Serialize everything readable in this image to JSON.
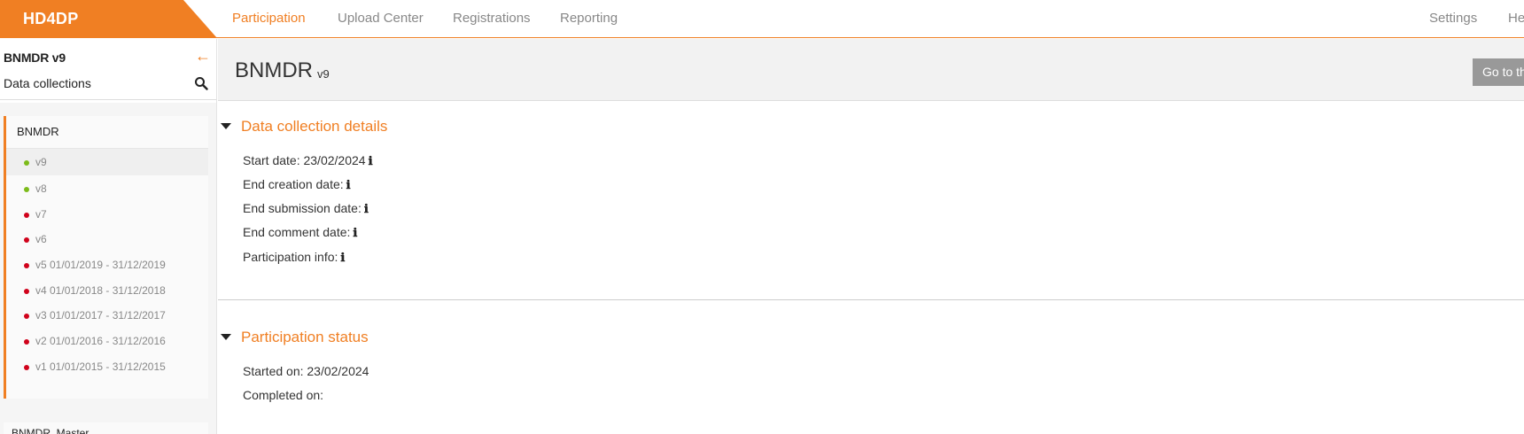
{
  "app": {
    "logo": "HD4DP"
  },
  "nav": {
    "participation": "Participation",
    "upload_center": "Upload Center",
    "registrations": "Registrations",
    "reporting": "Reporting",
    "settings": "Settings",
    "help": "He"
  },
  "sidebar": {
    "title": "BNMDR v9",
    "subtitle": "Data collections",
    "group_name": "BNMDR",
    "versions": [
      {
        "label": "v9",
        "status": "green"
      },
      {
        "label": "v8",
        "status": "green"
      },
      {
        "label": "v7",
        "status": "red"
      },
      {
        "label": "v6",
        "status": "red"
      },
      {
        "label": "v5 01/01/2019 - 31/12/2019",
        "status": "red"
      },
      {
        "label": "v4 01/01/2018 - 31/12/2018",
        "status": "red"
      },
      {
        "label": "v3 01/01/2017 - 31/12/2017",
        "status": "red"
      },
      {
        "label": "v2 01/01/2016 - 31/12/2016",
        "status": "red"
      },
      {
        "label": "v1 01/01/2015 - 31/12/2015",
        "status": "red"
      }
    ],
    "next_group": "BNMDR_Master"
  },
  "page": {
    "title": "BNMDR",
    "version": "v9",
    "goto_button": "Go to th"
  },
  "details": {
    "title": "Data collection details",
    "start_date": "Start date: 23/02/2024",
    "end_creation": "End creation date:",
    "end_submission": "End submission date:",
    "end_comment": "End comment date:",
    "participation_info": "Participation info:"
  },
  "status": {
    "title": "Participation status",
    "started_on": "Started on: 23/02/2024",
    "completed_on": "Completed on:"
  },
  "colors": {
    "accent": "#f07f23",
    "green": "#7cbb1a",
    "red": "#d0021b"
  },
  "icons": {
    "info": "ℹ",
    "back": "←"
  }
}
